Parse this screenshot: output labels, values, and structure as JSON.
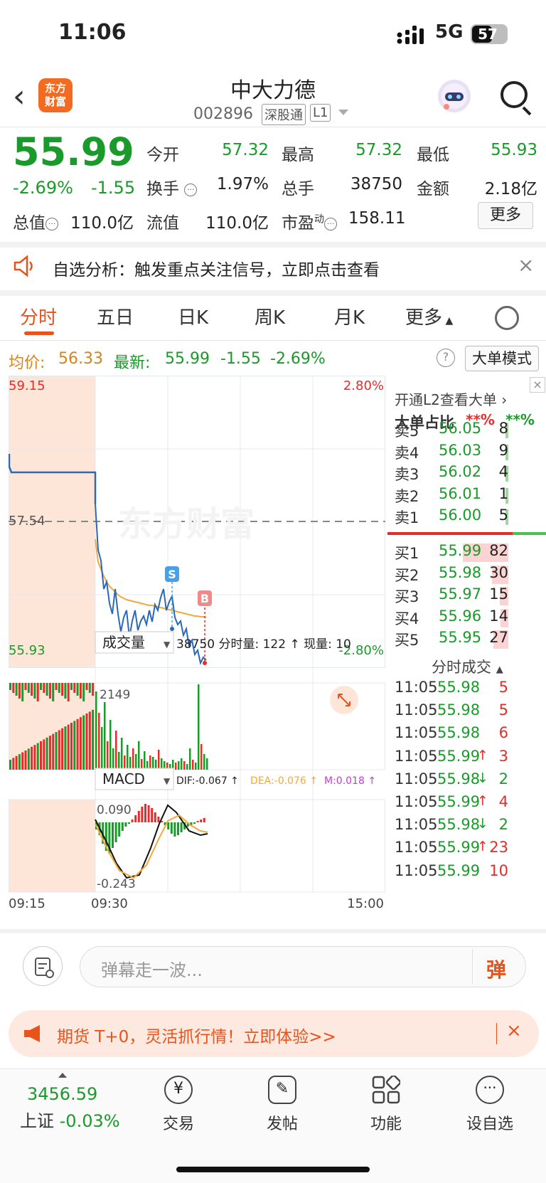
{
  "status": {
    "time": "11:06",
    "network": "5G",
    "battery": "57"
  },
  "header": {
    "logo": "东方财富",
    "name": "中大力德",
    "code": "002896",
    "tags": [
      "深股通",
      "L1"
    ]
  },
  "quote": {
    "price": "55.99",
    "pct": "-2.69%",
    "change": "-1.55",
    "open_label": "今开",
    "open": "57.32",
    "high_label": "最高",
    "high": "57.32",
    "low_label": "最低",
    "low": "55.93",
    "turnover_label": "换手",
    "turnover": "1.97%",
    "volume_label": "总手",
    "volume": "38750",
    "amount_label": "金额",
    "amount": "2.18亿",
    "mktcap_label": "总值",
    "mktcap": "110.0亿",
    "float_label": "流值",
    "float": "110.0亿",
    "pe_label": "市盈",
    "pe_sup": "动",
    "pe": "158.11",
    "more": "更多"
  },
  "banner": {
    "text": "自选分析：触发重点关注信号，立即点击查看"
  },
  "tabs": [
    "分时",
    "五日",
    "日K",
    "周K",
    "月K",
    "更多"
  ],
  "summary": {
    "avg_label": "均价:",
    "avg": "56.33",
    "latest_label": "最新:",
    "latest": "55.99",
    "latest_chg": "-1.55",
    "latest_pct": "-2.69%",
    "big_mode": "大单模式"
  },
  "chart": {
    "y_top": "59.15",
    "y_mid": "57.54",
    "y_bot": "55.93",
    "pct_top": "2.80%",
    "pct_bot": "-2.80%",
    "watermark": "东方财富",
    "vol_selector": "成交量",
    "vol_info": "38750 分时量: 122 ↑ 现量: 10",
    "vol_max": "2149",
    "macd_selector": "MACD",
    "dif": "DIF:-0.067 ↑",
    "dea": "DEA:-0.076 ↑",
    "m": "M:0.018 ↑",
    "macd_top": "0.090",
    "macd_bot": "-0.243",
    "times": [
      "09:15",
      "09:30",
      "15:00"
    ],
    "marker_s": "S",
    "marker_b": "B",
    "colors": {
      "up": "#e62b2b",
      "down": "#1a9a2a",
      "price_line": "#2a68b8",
      "avg_line": "#f2a93a"
    }
  },
  "orderbook": {
    "open_l2": "开通L2查看大单",
    "big_ratio": "大单占比",
    "ratio_sell": "**%",
    "ratio_buy": "**%",
    "asks": [
      {
        "label": "卖5",
        "price": "56.05",
        "vol": "8"
      },
      {
        "label": "卖4",
        "price": "56.03",
        "vol": "9"
      },
      {
        "label": "卖3",
        "price": "56.02",
        "vol": "4"
      },
      {
        "label": "卖2",
        "price": "56.01",
        "vol": "1"
      },
      {
        "label": "卖1",
        "price": "56.00",
        "vol": "5"
      }
    ],
    "bids": [
      {
        "label": "买1",
        "price": "55.99",
        "vol": "82"
      },
      {
        "label": "买2",
        "price": "55.98",
        "vol": "30"
      },
      {
        "label": "买3",
        "price": "55.97",
        "vol": "15"
      },
      {
        "label": "买4",
        "price": "55.96",
        "vol": "14"
      },
      {
        "label": "买5",
        "price": "55.95",
        "vol": "27"
      }
    ],
    "ticks_title": "分时成交",
    "ticks": [
      {
        "time": "11:05",
        "price": "55.98",
        "arrow": "",
        "vol": "5"
      },
      {
        "time": "11:05",
        "price": "55.98",
        "arrow": "",
        "vol": "5"
      },
      {
        "time": "11:05",
        "price": "55.98",
        "arrow": "",
        "vol": "6"
      },
      {
        "time": "11:05",
        "price": "55.99",
        "arrow": "↑",
        "vol": "3"
      },
      {
        "time": "11:05",
        "price": "55.98",
        "arrow": "↓",
        "vol": "2"
      },
      {
        "time": "11:05",
        "price": "55.99",
        "arrow": "↑",
        "vol": "4"
      },
      {
        "time": "11:05",
        "price": "55.98",
        "arrow": "↓",
        "vol": "2"
      },
      {
        "time": "11:05",
        "price": "55.99",
        "arrow": "↑",
        "vol": "23"
      },
      {
        "time": "11:05",
        "price": "55.99",
        "arrow": "",
        "vol": "10"
      }
    ]
  },
  "comment": {
    "placeholder": "弹幕走一波...",
    "button": "弹"
  },
  "promo": {
    "text": "期货 T+0，灵活抓行情！立即体验>>"
  },
  "nav": {
    "index_value": "3456.59",
    "index_name": "上证",
    "index_pct": "-0.03%",
    "items": [
      "交易",
      "发帖",
      "功能",
      "设自选"
    ]
  }
}
